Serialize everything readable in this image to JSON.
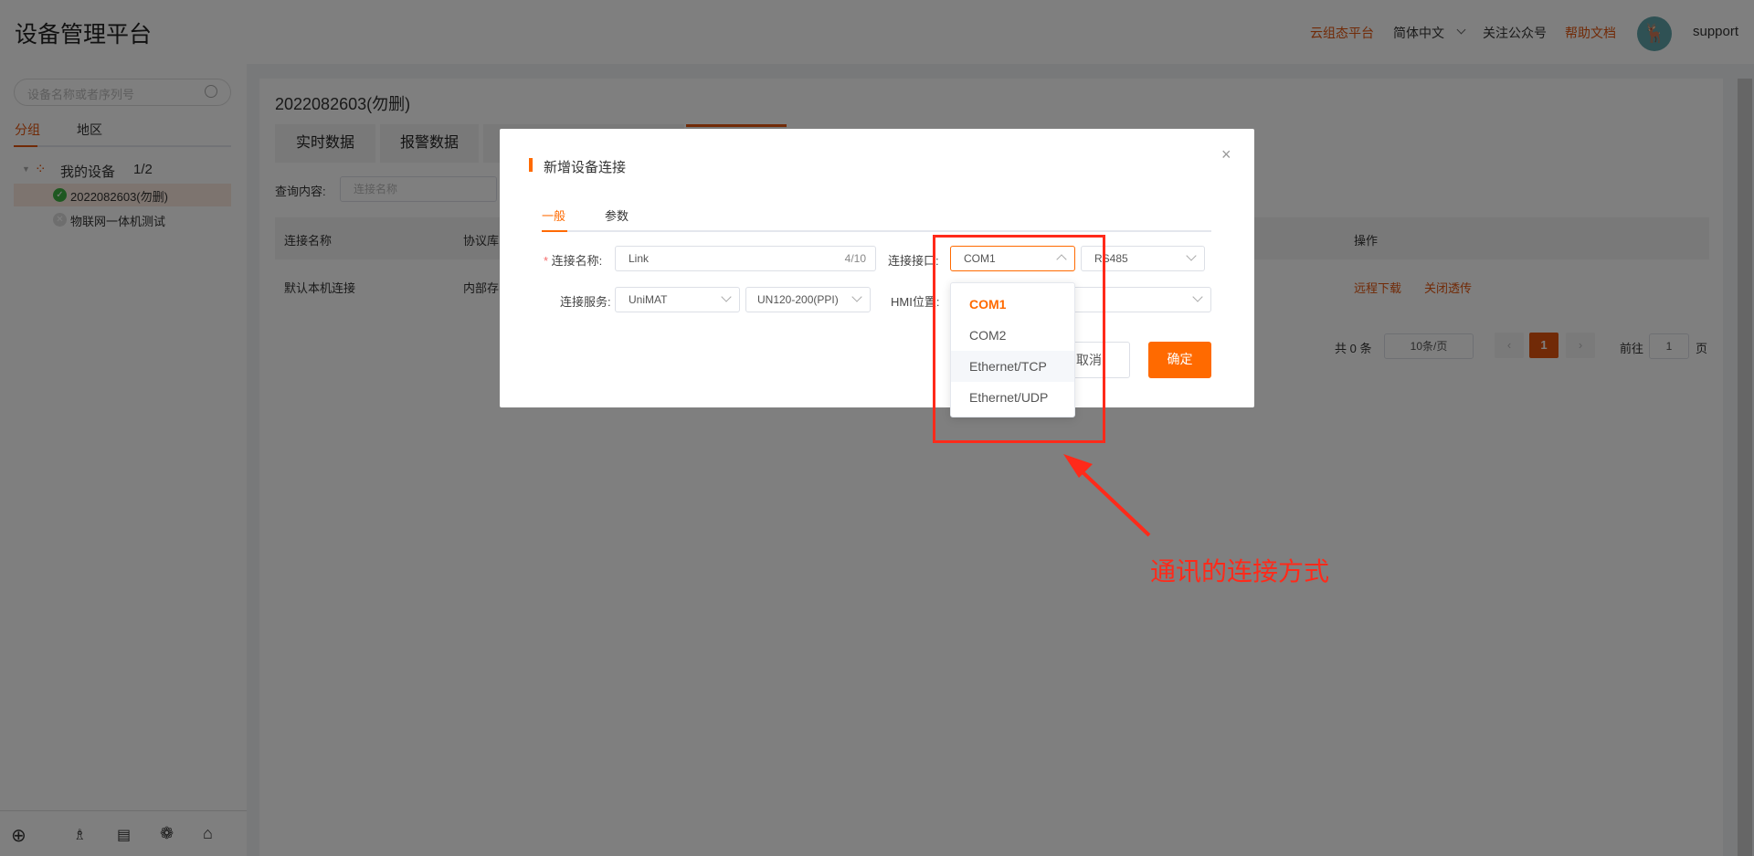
{
  "header": {
    "title": "设备管理平台",
    "links": [
      "云组态平台",
      "简体中文",
      "关注公众号",
      "帮助文档"
    ],
    "user": "support",
    "accent": "#ff6a00"
  },
  "sidebar": {
    "search_placeholder": "设备名称或者序列号",
    "tabs": [
      "分组",
      "地区"
    ],
    "group": "我的设备",
    "group_count": "1/2",
    "devices": [
      {
        "name": "2022082603(勿删)",
        "status": "online"
      },
      {
        "name": "物联网一体机测试",
        "status": "offline"
      }
    ]
  },
  "main": {
    "device_title": "2022082603(勿删)",
    "tabs": [
      "实时数据",
      "报警数据"
    ],
    "query_label": "查询内容:",
    "query_placeholder": "连接名称",
    "columns": [
      "连接名称",
      "协议库",
      "操作"
    ],
    "row": {
      "name": "默认本机连接",
      "protocol": "内部存",
      "actions": [
        "远程下载",
        "关闭透传"
      ]
    },
    "pagination": {
      "total": "共 0 条",
      "page_size": "10条/页",
      "current": "1",
      "goto_label": "前往",
      "goto_value": "1",
      "page_suffix": "页"
    }
  },
  "modal": {
    "title": "新增设备连接",
    "tabs": [
      "一般",
      "参数"
    ],
    "name_label": "连接名称:",
    "name_value": "Link",
    "name_count": "4/10",
    "port_label": "连接接口:",
    "port_value": "COM1",
    "port_mode": "RS485",
    "service_label": "连接服务:",
    "service_value": "UniMAT",
    "model_value": "UN120-200(PPI)",
    "hmi_label": "HMI位置:",
    "cancel": "取消",
    "confirm": "确定",
    "port_options": [
      "COM1",
      "COM2",
      "Ethernet/TCP",
      "Ethernet/UDP"
    ],
    "selected_option": "COM1",
    "hovered_option": "Ethernet/TCP"
  },
  "annotation": {
    "text": "通讯的连接方式",
    "color": "#ff2a1a"
  }
}
